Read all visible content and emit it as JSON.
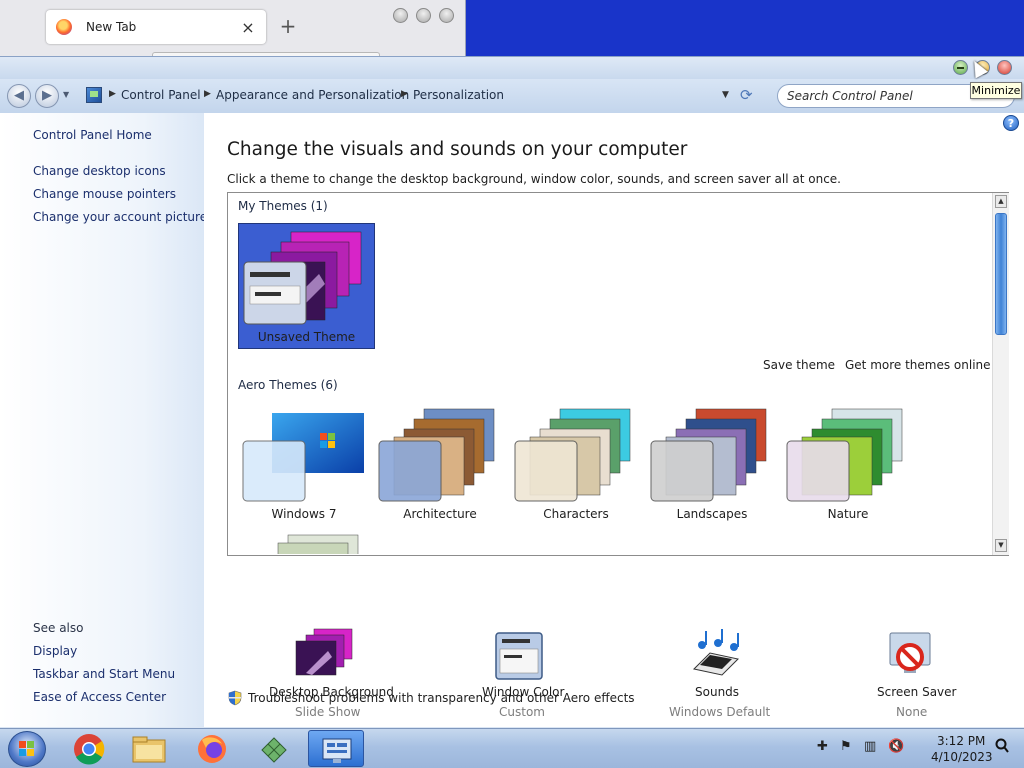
{
  "firefox": {
    "tab_title": "New Tab",
    "tab_close": "×",
    "new_tab": "+"
  },
  "window": {
    "tooltip": "Minimize"
  },
  "navbar": {
    "breadcrumb": [
      "Control Panel",
      "Appearance and Personalization",
      "Personalization"
    ],
    "search_placeholder": "Search Control Panel"
  },
  "sidebar": {
    "home": "Control Panel Home",
    "links": [
      "Change desktop icons",
      "Change mouse pointers",
      "Change your account picture"
    ],
    "see_also_title": "See also",
    "see_also": [
      "Display",
      "Taskbar and Start Menu",
      "Ease of Access Center"
    ]
  },
  "main": {
    "title": "Change the visuals and sounds on your computer",
    "subtitle": "Click a theme to change the desktop background, window color, sounds, and screen saver all at once.",
    "my_themes_title": "My Themes (1)",
    "unsaved_theme": "Unsaved Theme",
    "save_theme": "Save theme",
    "get_more": "Get more themes online",
    "aero_title": "Aero Themes (6)",
    "aero_themes": [
      "Windows 7",
      "Architecture",
      "Characters",
      "Landscapes",
      "Nature"
    ]
  },
  "bottom": {
    "items": [
      {
        "label": "Desktop Background",
        "value": "Slide Show"
      },
      {
        "label": "Window Color",
        "value": "Custom"
      },
      {
        "label": "Sounds",
        "value": "Windows Default"
      },
      {
        "label": "Screen Saver",
        "value": "None"
      }
    ],
    "troubleshoot": "Troubleshoot problems with transparency and other Aero effects"
  },
  "taskbar": {
    "time": "3:12 PM",
    "date": "4/10/2023"
  },
  "colors": {
    "desktop": "#1934c9",
    "selected_theme": "#3b5ed1",
    "link": "#1b2f6d"
  }
}
